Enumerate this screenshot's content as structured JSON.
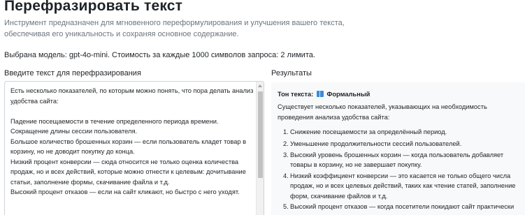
{
  "header": {
    "title": "Перефразировать текст",
    "description": "Инструмент предназначен для мгновенного переформулирования и улучшения вашего текста, обеспечивая его уникальность и сохраняя основное содержание."
  },
  "model_info": "Выбрана модель: gpt-4o-mini. Стоимость за каждые 1000 символов запроса: 2 лимита.",
  "input": {
    "label": "Введите текст для перефразирования",
    "value": "Есть несколько показателей, по которым можно понять, что пора делать анализ удобства сайта:\n\nПадение посещаемости в течение определенного периода времени.\nСокращение длины сессии пользователя.\nБольшое количество брошенных корзин — если пользователь кладет товар в корзину, но не доводит покупку до конца.\nНизкий процент конверсии — сюда относится не только оценка количества продаж, но и всех действий, которые можно отнести к целевым: дочитывание статьи, заполнение формы, скачивание файла и т.д.\nВысокий процент отказов — если на сайт кликают, но быстро с него уходят."
  },
  "results": {
    "label": "Результаты",
    "tone_label": "Тон текста:",
    "tone_icon": "book-icon",
    "tone_value": "Формальный",
    "intro": "Существует несколько показателей, указывающих на необходимость проведения анализа удобства сайта:",
    "items": [
      {
        "num": "1.",
        "text": "Снижение посещаемости за определённый период."
      },
      {
        "num": "2.",
        "text": "Уменьшение продолжительности сессий пользователей."
      },
      {
        "num": "3.",
        "text": "Высокий уровень брошенных корзин — когда пользователь добавляет товары в корзину, но не завершает покупку."
      },
      {
        "num": "4.",
        "text": "Низкий коэффициент конверсии — это касается не только общего числа продаж, но и всех целевых действий, таких как чтение статей, заполнение форм, скачивание файлов и т.д."
      },
      {
        "num": "5.",
        "text": "Высокий процент отказов — когда посетители покидают сайт практически сразу после перехода."
      }
    ]
  },
  "colors": {
    "description": "#6c757d",
    "results_bg": "#f8f9fa",
    "border": "#ced4da",
    "icon_blue": "#3d8bd7"
  }
}
